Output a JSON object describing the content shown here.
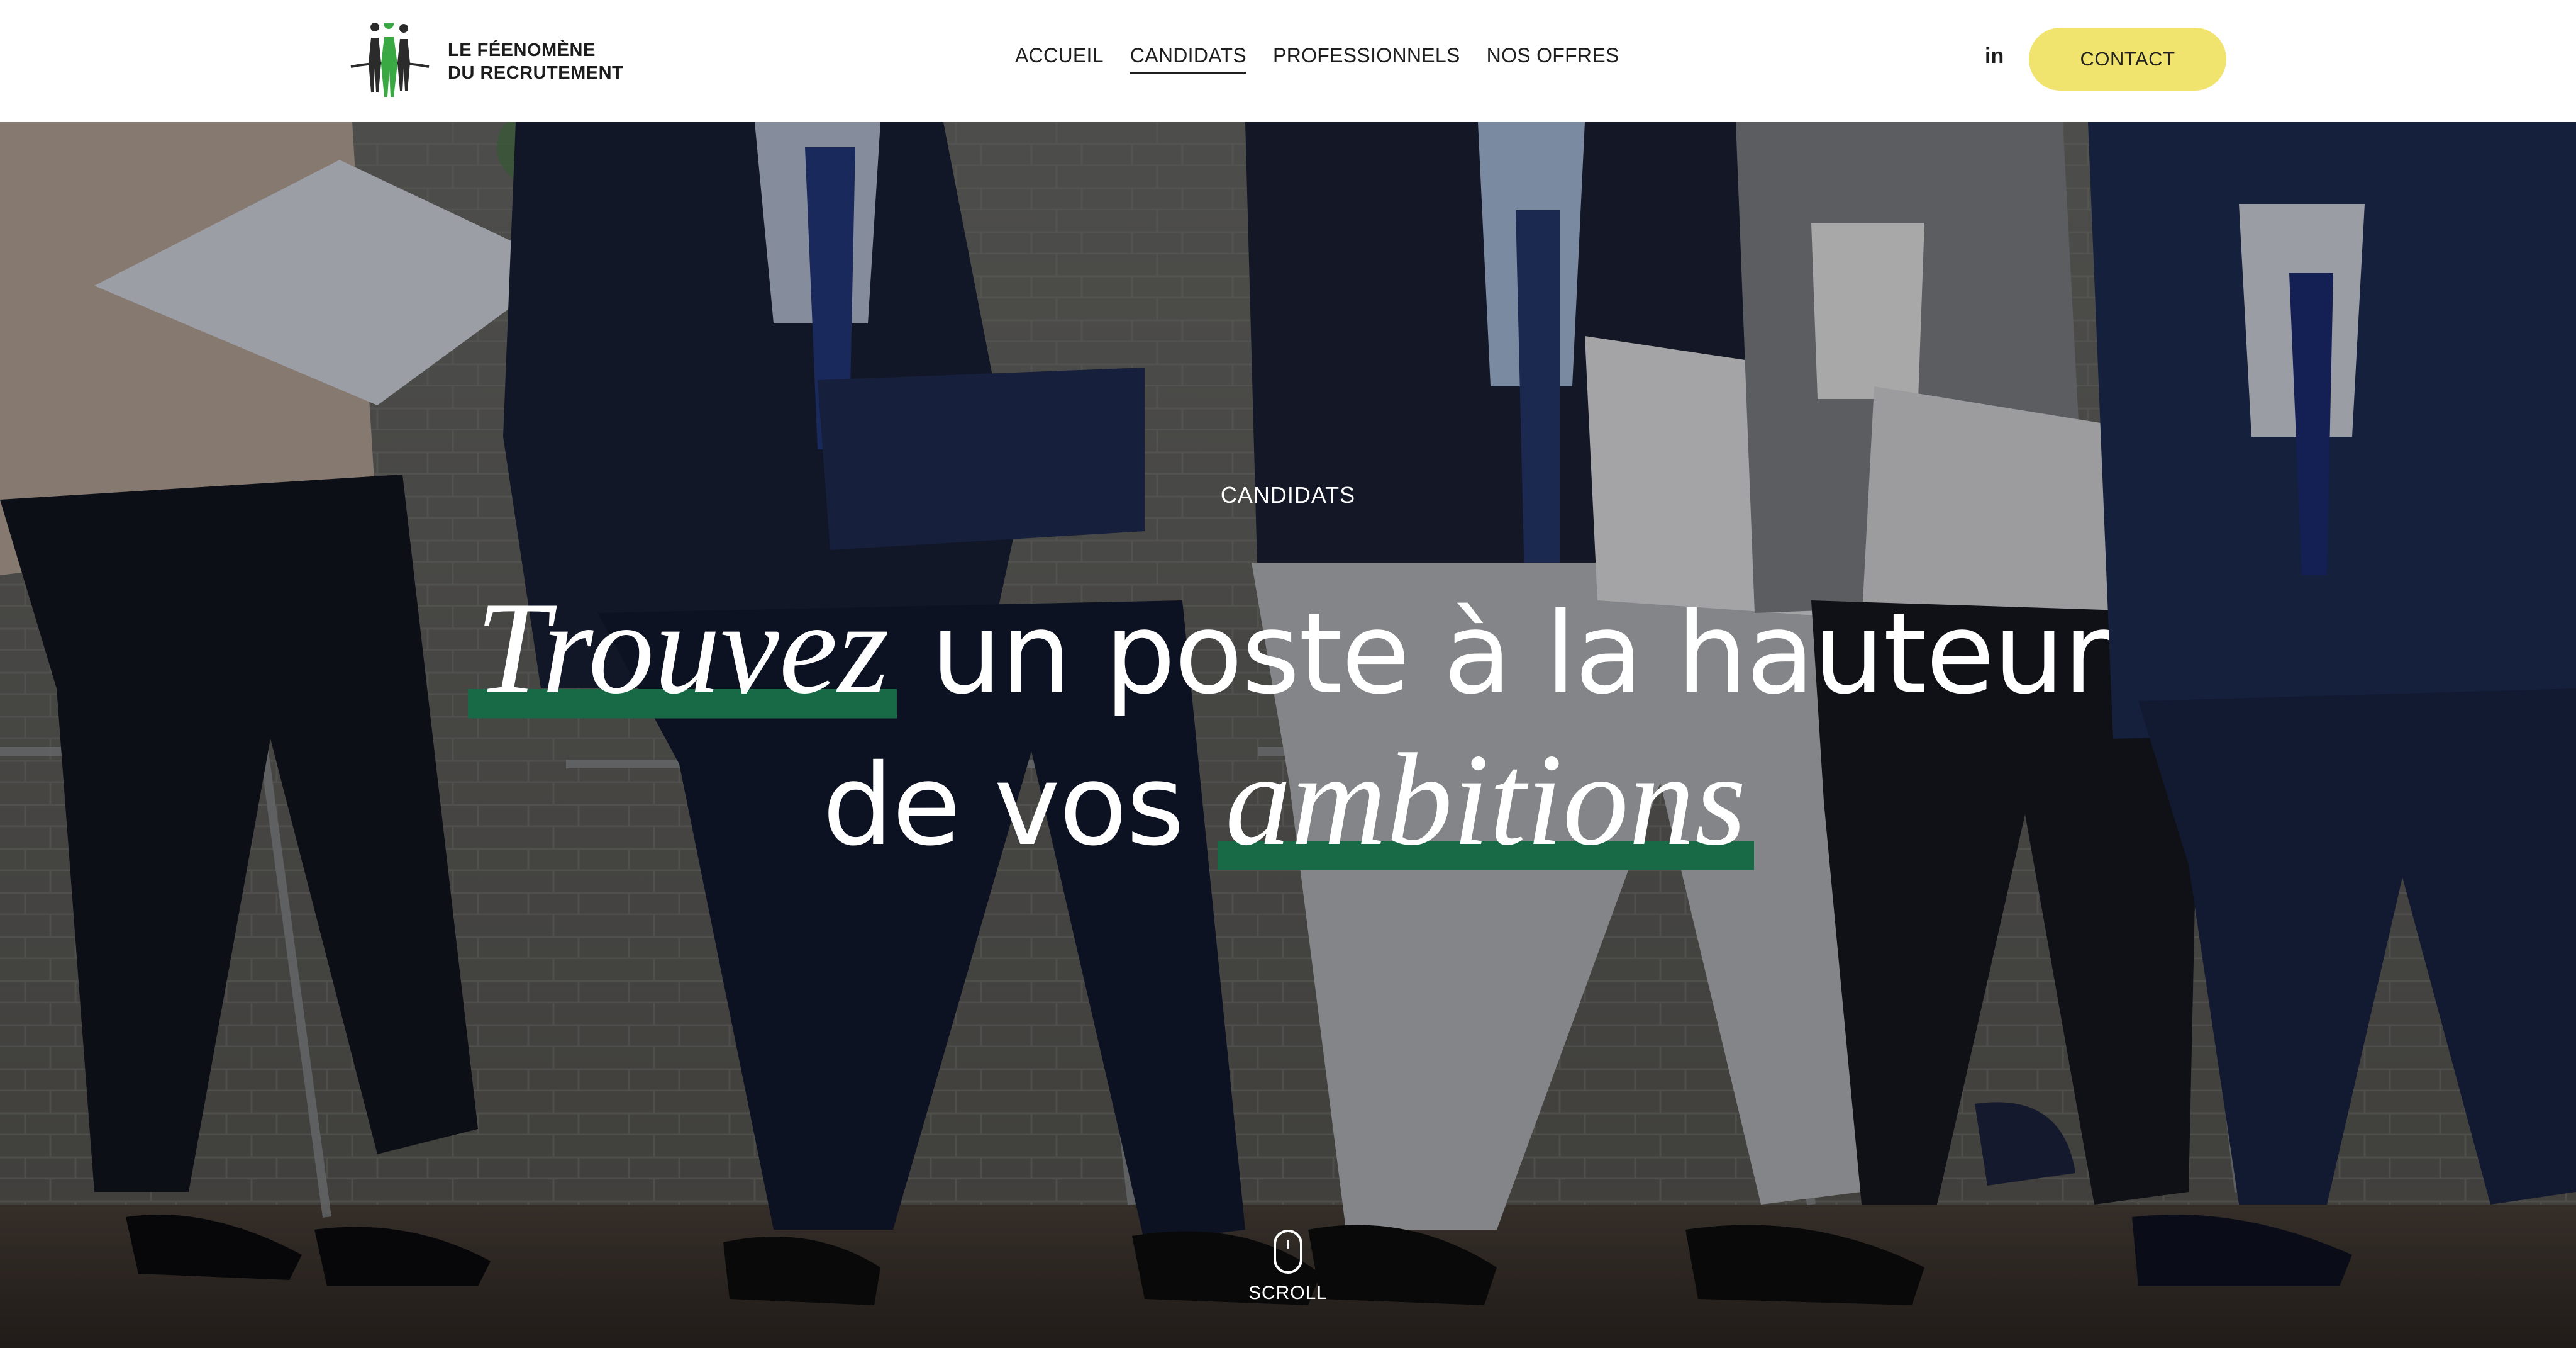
{
  "header": {
    "logo": {
      "line1": "LE FÉENOMÈNE",
      "line2": "DU RECRUTEMENT"
    },
    "nav": [
      {
        "label": "ACCUEIL",
        "active": false
      },
      {
        "label": "CANDIDATS",
        "active": true
      },
      {
        "label": "PROFESSIONNELS",
        "active": false
      },
      {
        "label": "NOS OFFRES",
        "active": false
      }
    ],
    "linkedin_label": "in",
    "contact_label": "CONTACT"
  },
  "hero": {
    "eyebrow": "CANDIDATS",
    "title": {
      "line1_em": "Trouvez",
      "line1_rest": " un poste à la hauteur",
      "line2_start": "de vos ",
      "line2_em": "ambitions"
    },
    "scroll_label": "SCROLL"
  },
  "colors": {
    "accent_yellow": "#f0e36e",
    "highlight_green": "#176a45",
    "logo_green": "#3aa843",
    "text_dark": "#1e1e1e"
  },
  "icons": {
    "logo": "women-silhouettes-logo",
    "linkedin": "linkedin-icon",
    "scroll": "mouse-icon"
  }
}
